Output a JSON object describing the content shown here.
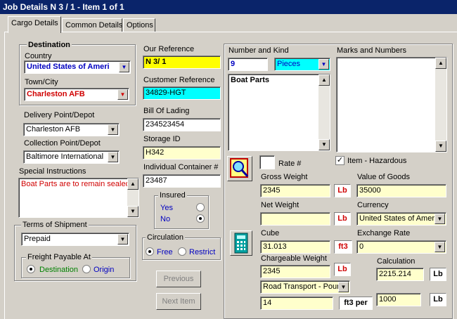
{
  "window": {
    "title": "Job Details N 3 /  1 - Item 1 of  1"
  },
  "tabs": [
    {
      "label": "Cargo Details"
    },
    {
      "label": "Common Details"
    },
    {
      "label": "Options"
    }
  ],
  "destination": {
    "title": "Destination",
    "country_label": "Country",
    "country_value": "United States of Ameri",
    "town_label": "Town/City",
    "town_value": "Charleston AFB"
  },
  "delivery": {
    "label": "Delivery Point/Depot",
    "value": "Charleston AFB"
  },
  "collection": {
    "label": "Collection Point/Depot",
    "value": "Baltimore  International"
  },
  "special": {
    "label": "Special Instructions",
    "value": "Boat Parts are to remain sealed"
  },
  "terms": {
    "title": "Terms of Shipment",
    "value": "Prepaid",
    "freight_title": "Freight Payable At",
    "destination_label": "Destination",
    "origin_label": "Origin"
  },
  "reference": {
    "our_label": "Our Reference",
    "our_value": "N 3/ 1",
    "customer_label": "Customer Reference",
    "customer_value": "34829-HGT",
    "bol_label": "Bill Of Lading",
    "bol_value": "234523454",
    "storage_label": "Storage ID",
    "storage_value": "H342",
    "container_label": "Individual Container #",
    "container_value": "23487"
  },
  "insured": {
    "title": "Insured",
    "yes": "Yes",
    "no": "No"
  },
  "circulation": {
    "title": "Circulation",
    "free": "Free",
    "restrict": "Restrict"
  },
  "buttons": {
    "previous": "Previous",
    "next": "Next Item"
  },
  "cargo": {
    "number_label": "Number and Kind",
    "number_value": "9",
    "kind_value": "Pieces",
    "description": "Boat Parts",
    "marks_label": "Marks and Numbers",
    "rate_label": "Rate #",
    "hazardous_label": "Item - Hazardous",
    "hazardous_mark": "✓",
    "gross_label": "Gross Weight",
    "gross_value": "2345",
    "gross_unit": "Lb",
    "net_label": "Net Weight",
    "net_value": "",
    "net_unit": "Lb",
    "cube_label": "Cube",
    "cube_value": "31.013",
    "cube_unit": "ft3",
    "chargeable_label": "Chargeable Weight",
    "chargeable_value": "2345",
    "chargeable_unit": "Lb",
    "transport_value": "Road Transport - Pour",
    "factor_value": "14",
    "factor_unit": "ft3 per",
    "value_label": "Value of Goods",
    "value_value": "35000",
    "currency_label": "Currency",
    "currency_value": "United States of Amer",
    "exchange_label": "Exchange Rate",
    "exchange_value": "0",
    "calc_label": "Calculation",
    "calc_value": "2215.214",
    "calc_unit": "Lb",
    "calc2_value": "1000",
    "calc2_unit": "Lb"
  }
}
